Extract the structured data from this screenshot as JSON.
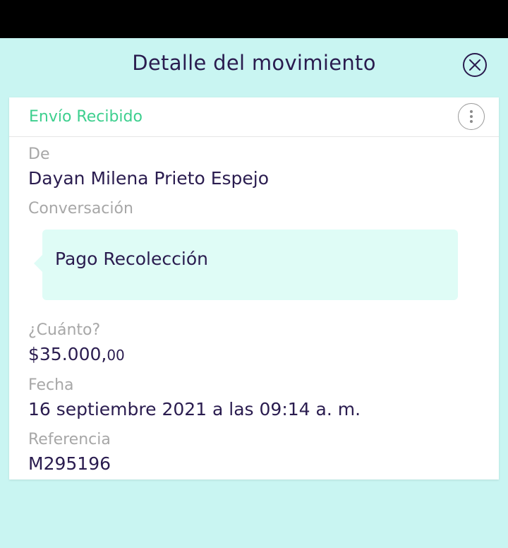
{
  "header": {
    "title": "Detalle del movimiento"
  },
  "card": {
    "title": "Envío Recibido",
    "from_label": "De",
    "from_value": "Dayan Milena Prieto Espejo",
    "conversation_label": "Conversación",
    "conversation_message": "Pago Recolección",
    "amount_label": "¿Cuánto?",
    "amount_main": "$35.000,",
    "amount_cents": "00",
    "date_label": "Fecha",
    "date_value": "16 septiembre 2021 a las 09:14 a. m.",
    "reference_label": "Referencia",
    "reference_value": "M295196"
  },
  "icons": {
    "close": "close-icon",
    "more": "more-vertical-icon"
  },
  "colors": {
    "background": "#c9f5f2",
    "accent_green": "#3dcf8e",
    "text_dark": "#2a1c4f",
    "text_muted": "#a7a7a7",
    "bubble": "#dffcf6"
  }
}
